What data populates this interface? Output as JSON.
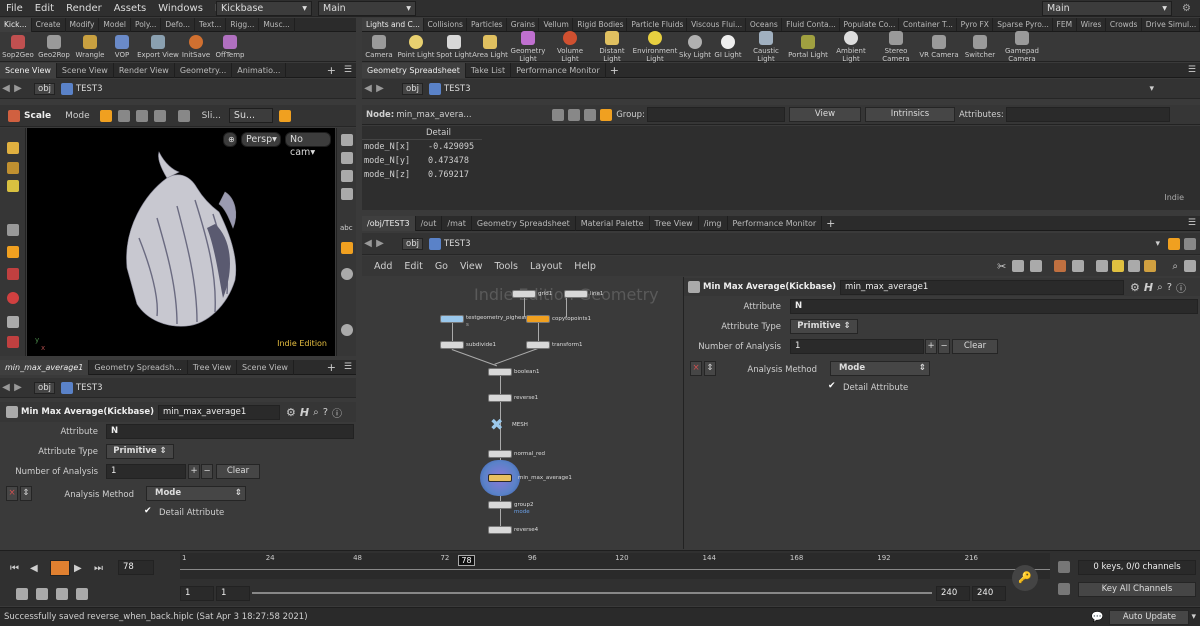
{
  "menubar": {
    "items": [
      "File",
      "Edit",
      "Render",
      "Assets",
      "Windows",
      "Help"
    ],
    "desktop": "Kickbase",
    "main_left": "Main",
    "main_right": "Main"
  },
  "shelf_left": {
    "tabs": [
      "Kick...",
      "Create",
      "Modify",
      "Model",
      "Poly...",
      "Defo...",
      "Text...",
      "Rigg...",
      "Musc..."
    ],
    "tools": [
      "Sop2Geo",
      "Geo2Rop",
      "Wrangle",
      "VOP",
      "Export View",
      "InitSave",
      "OffTemp"
    ]
  },
  "shelf_right": {
    "tabs": [
      "Lights and C...",
      "Collisions",
      "Particles",
      "Grains",
      "Vellum",
      "Rigid Bodies",
      "Particle Fluids",
      "Viscous Flui...",
      "Oceans",
      "Fluid Conta...",
      "Populate Co...",
      "Container T...",
      "Pyro FX",
      "Sparse Pyro...",
      "FEM",
      "Wires",
      "Crowds",
      "Drive Simul..."
    ],
    "tools": [
      "Camera",
      "Point Light",
      "Spot Light",
      "Area Light",
      "Geometry Light",
      "Volume Light",
      "Distant Light",
      "Environment Light",
      "Sky Light",
      "GI Light",
      "Caustic Light",
      "Portal Light",
      "Ambient Light",
      "Stereo Camera",
      "VR Camera",
      "Switcher",
      "Gamepad Camera"
    ]
  },
  "viewport": {
    "tabs": [
      "Scene View",
      "Scene View",
      "Render View",
      "Geometry...",
      "Animatio..."
    ],
    "path": [
      "obj",
      "TEST3"
    ],
    "tool": "Scale",
    "mode": "Mode",
    "sli": "Sli...",
    "su": "Su...",
    "persp": "Persp",
    "nocam": "No cam",
    "edition": "Indie Edition"
  },
  "spreadsheet": {
    "tabs": [
      "Geometry Spreadsheet",
      "Take List",
      "Performance Monitor"
    ],
    "path": [
      "obj",
      "TEST3"
    ],
    "node_label": "Node:",
    "node_value": "min_max_avera...",
    "group_label": "Group:",
    "view": "View",
    "intrinsics": "Intrinsics",
    "attributes_label": "Attributes:",
    "col_header": "Detail",
    "rows": [
      {
        "name": "mode_N[x]",
        "value": "-0.429095"
      },
      {
        "name": "mode_N[y]",
        "value": "0.473478"
      },
      {
        "name": "mode_N[z]",
        "value": "0.769217"
      }
    ],
    "watermark": "Indie"
  },
  "network": {
    "tabs": [
      "/obj/TEST3",
      "/out",
      "/mat",
      "Geometry Spreadsheet",
      "Material Palette",
      "Tree View",
      "/img",
      "Performance Monitor"
    ],
    "path": [
      "obj",
      "TEST3"
    ],
    "menu": [
      "Add",
      "Edit",
      "Go",
      "View",
      "Tools",
      "Layout",
      "Help"
    ],
    "watermark": "Indie Edition Geometry",
    "nodes": [
      "grid1",
      "line1",
      "testgeometry_pighead1",
      "copytopoints1",
      "subdivide1",
      "transform1",
      "boolean1",
      "reverse1",
      "MESH",
      "normal_red",
      "min_max_average1",
      "group2",
      "reverse4"
    ],
    "node_sublabels": {
      "testgeometry_pighead1": "s",
      "group2": "mode"
    }
  },
  "params_right": {
    "title": "Min Max Average(Kickbase)",
    "name": "min_max_average1",
    "attribute_label": "Attribute",
    "attribute_value": "N",
    "attrtype_label": "Attribute Type",
    "attrtype_value": "Primitive",
    "count_label": "Number of Analysis",
    "count_value": "1",
    "clear": "Clear",
    "method_label": "Analysis Method",
    "method_value": "Mode",
    "detail_label": "Detail Attribute"
  },
  "params_left": {
    "tabs": [
      "min_max_average1",
      "Geometry Spreadsh...",
      "Tree View",
      "Scene View"
    ],
    "path": [
      "obj",
      "TEST3"
    ],
    "title": "Min Max Average(Kickbase)",
    "name": "min_max_average1",
    "attribute_label": "Attribute",
    "attribute_value": "N",
    "attrtype_label": "Attribute Type",
    "attrtype_value": "Primitive",
    "count_label": "Number of Analysis",
    "count_value": "1",
    "clear": "Clear",
    "method_label": "Analysis Method",
    "method_value": "Mode",
    "detail_label": "Detail Attribute"
  },
  "timeline": {
    "frame": "78",
    "ticks": [
      "1",
      "24",
      "48",
      "72",
      "96",
      "120",
      "144",
      "168",
      "192",
      "216"
    ],
    "marker": "78",
    "range_start": "1",
    "range_start2": "1",
    "range_end": "240",
    "range_end2": "240",
    "keys": "0 keys, 0/0 channels",
    "key_all": "Key All Channels",
    "current_fraction": 0.32
  },
  "status": {
    "message": "Successfully saved reverse_when_back.hiplc (Sat Apr  3 18:27:58 2021)",
    "auto_update": "Auto Update"
  },
  "colors": {
    "accent_orange": "#f0a020",
    "selected_node": "#5a82c8"
  }
}
